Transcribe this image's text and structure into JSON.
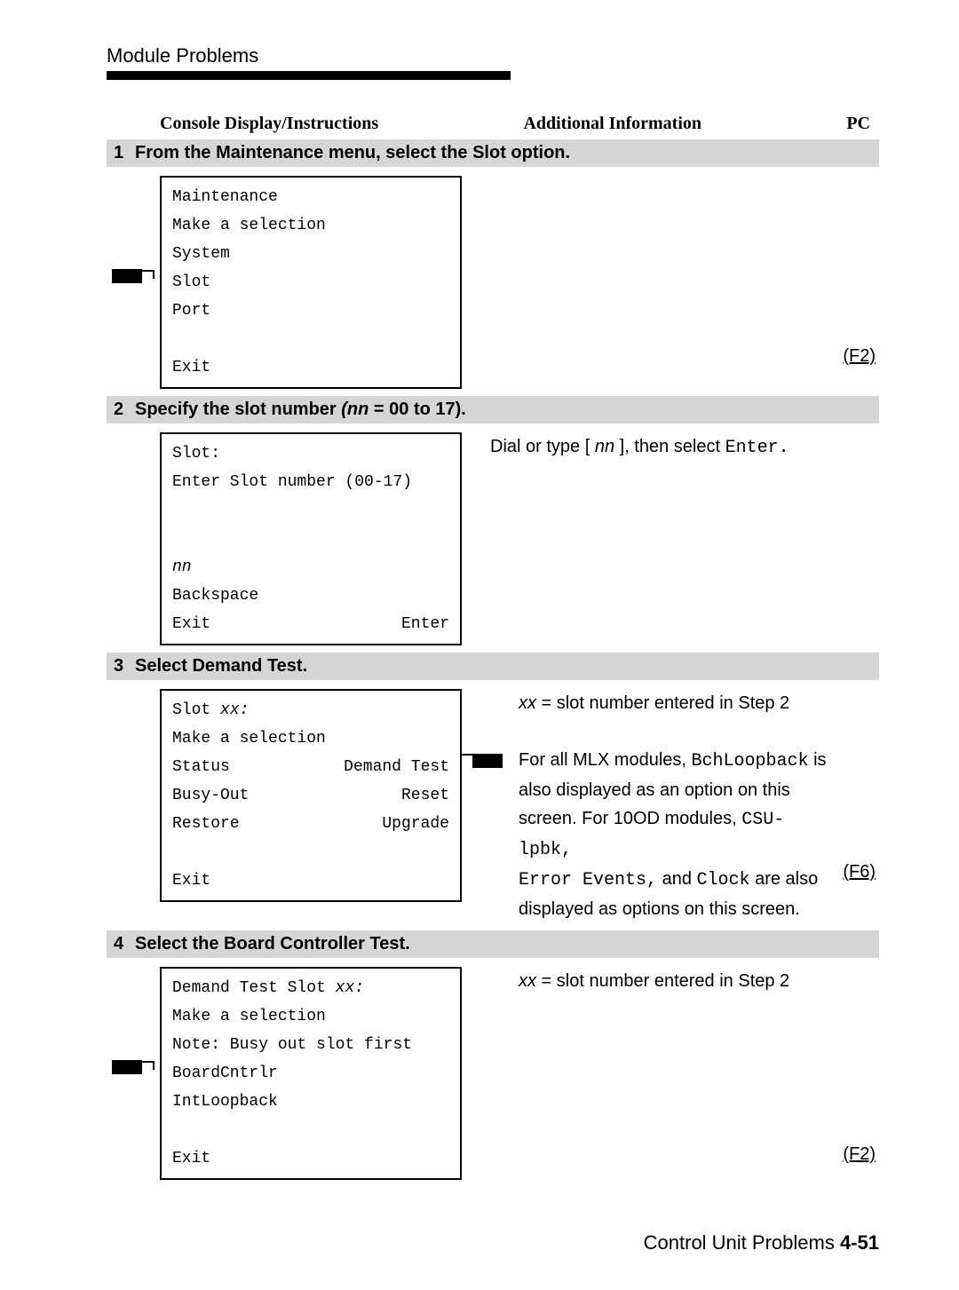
{
  "page": {
    "section_title": "Module Problems",
    "header": {
      "left": "Console Display/Instructions",
      "mid": "Additional Information",
      "right": "PC"
    },
    "footer": {
      "text": "Control Unit Problems",
      "page": "4-51"
    }
  },
  "steps": [
    {
      "num": "1",
      "title_plain": "From the Maintenance menu, select the Slot option.",
      "console": {
        "lines": [
          "Maintenance",
          "Make a selection",
          "System",
          "Slot",
          "Port",
          " ",
          "Exit"
        ]
      },
      "left_marker_line_index": 3,
      "info_lines": [],
      "pc": {
        "label": "(F2)",
        "align_line": 6
      }
    },
    {
      "num": "2",
      "title_prefix": "Specify the slot number ",
      "title_ital": "(nn",
      "title_suffix": " = 00 to 17).",
      "console": {
        "lines": [
          "Slot:",
          "Enter Slot number (00-17)",
          " ",
          " "
        ],
        "ital_line": "nn",
        "tail_lines": [
          "Backspace"
        ],
        "bottom_row": {
          "left": "Exit",
          "right": "Enter"
        }
      },
      "info_segments_line0": [
        {
          "t": "Dial or type [ "
        },
        {
          "t": "nn",
          "ital": true
        },
        {
          "t": " ], then select "
        },
        {
          "t": "Enter.",
          "mono": true
        }
      ]
    },
    {
      "num": "3",
      "title_plain": "Select Demand Test.",
      "console": {
        "pair_rows": [
          {
            "left_ital_prefix": "Slot ",
            "left_ital": "xx:",
            "right": ""
          },
          {
            "left": "Make a selection",
            "right": ""
          },
          {
            "left": "Status",
            "right": "Demand Test"
          },
          {
            "left": "Busy-Out",
            "right": "Reset"
          },
          {
            "left": "Restore",
            "right": "Upgrade"
          },
          {
            "left": " ",
            "right": ""
          },
          {
            "left": "Exit",
            "right": ""
          }
        ]
      },
      "info_marker_line_index": 2,
      "info_first_segments": [
        {
          "t": "xx",
          "ital": true
        },
        {
          "t": " = slot number entered in Step 2"
        }
      ],
      "info_rich_lines": [
        [
          {
            "t": "For all MLX modules, "
          },
          {
            "t": "BchLoopback",
            "mono": true
          },
          {
            "t": " is"
          }
        ],
        [
          {
            "t": "also displayed as an option on this"
          }
        ],
        [
          {
            "t": "screen. For 10OD modules, "
          },
          {
            "t": "CSU-lpbk,",
            "mono": true
          }
        ],
        [
          {
            "t": "Error Events,",
            "mono": true
          },
          {
            "t": " and "
          },
          {
            "t": "Clock",
            "mono": true
          },
          {
            "t": " are also"
          }
        ],
        [
          {
            "t": "displayed as options on this screen."
          }
        ]
      ],
      "pc": {
        "label": "(F6)",
        "align_line": 6
      }
    },
    {
      "num": "4",
      "title_plain": "Select the Board Controller Test.",
      "console": {
        "lines_rich": [
          [
            {
              "t": "Demand Test Slot "
            },
            {
              "t": "xx:",
              "ital": true
            }
          ],
          [
            {
              "t": "Make a selection"
            }
          ],
          [
            {
              "t": "Note: Busy out slot first"
            }
          ],
          [
            {
              "t": "BoardCntrlr"
            }
          ],
          [
            {
              "t": "IntLoopback"
            }
          ],
          [
            {
              "t": " "
            }
          ],
          [
            {
              "t": "Exit"
            }
          ]
        ]
      },
      "left_marker_line_index": 3,
      "info_first_segments": [
        {
          "t": "xx",
          "ital": true
        },
        {
          "t": " = slot number entered in Step 2"
        }
      ],
      "pc": {
        "label": "(F2)",
        "align_line": 6
      }
    }
  ]
}
